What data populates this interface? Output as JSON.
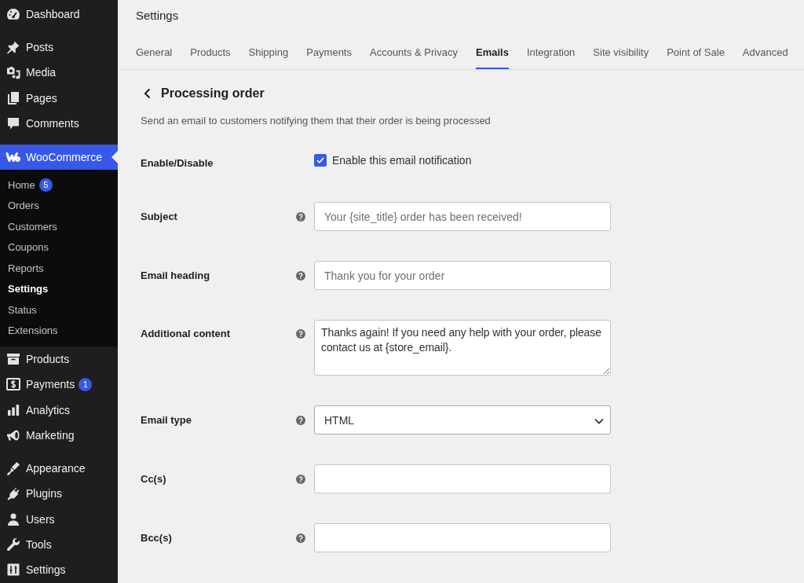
{
  "sidebar": {
    "sections": [
      {
        "items": [
          {
            "label": "Dashboard",
            "selected": false
          }
        ]
      },
      {
        "items": [
          {
            "label": "Posts",
            "selected": false
          },
          {
            "label": "Media",
            "selected": false
          },
          {
            "label": "Pages",
            "selected": false
          },
          {
            "label": "Comments",
            "selected": false
          }
        ]
      },
      {
        "items": [
          {
            "label": "WooCommerce",
            "selected": true,
            "children": [
              {
                "label": "Home",
                "selected": false,
                "badge": "5"
              },
              {
                "label": "Orders",
                "selected": false
              },
              {
                "label": "Customers",
                "selected": false
              },
              {
                "label": "Coupons",
                "selected": false
              },
              {
                "label": "Reports",
                "selected": false
              },
              {
                "label": "Settings",
                "selected": true
              },
              {
                "label": "Status",
                "selected": false
              },
              {
                "label": "Extensions",
                "selected": false
              }
            ]
          },
          {
            "label": "Products",
            "selected": false
          },
          {
            "label": "Payments",
            "selected": false,
            "badge": "1"
          },
          {
            "label": "Analytics",
            "selected": false
          },
          {
            "label": "Marketing",
            "selected": false
          }
        ]
      },
      {
        "items": [
          {
            "label": "Appearance",
            "selected": false
          },
          {
            "label": "Plugins",
            "selected": false
          },
          {
            "label": "Users",
            "selected": false
          },
          {
            "label": "Tools",
            "selected": false
          },
          {
            "label": "Settings",
            "selected": false
          }
        ]
      }
    ]
  },
  "header": {
    "title": "Settings",
    "tabs": [
      {
        "label": "General",
        "selected": false
      },
      {
        "label": "Products",
        "selected": false
      },
      {
        "label": "Shipping",
        "selected": false
      },
      {
        "label": "Payments",
        "selected": false
      },
      {
        "label": "Accounts & Privacy",
        "selected": false
      },
      {
        "label": "Emails",
        "selected": true
      },
      {
        "label": "Integration",
        "selected": false
      },
      {
        "label": "Site visibility",
        "selected": false
      },
      {
        "label": "Point of Sale",
        "selected": false
      },
      {
        "label": "Advanced",
        "selected": false
      }
    ]
  },
  "page": {
    "title": "Processing order",
    "description": "Send an email to customers notifying them that their order is being processed",
    "fields": [
      {
        "kind": "checkbox",
        "label": "Enable/Disable",
        "checked": true,
        "option_label": "Enable this email notification"
      },
      {
        "kind": "text",
        "label": "Subject",
        "placeholder": "Your {site_title} order has been received!"
      },
      {
        "kind": "text",
        "label": "Email heading",
        "placeholder": "Thank you for your order"
      },
      {
        "kind": "textarea",
        "label": "Additional content",
        "value": "Thanks again! If you need any help with your order, please contact us at {store_email}."
      },
      {
        "kind": "select",
        "label": "Email type",
        "value": "HTML"
      },
      {
        "kind": "text",
        "label": "Cc(s)"
      },
      {
        "kind": "text",
        "label": "Bcc(s)"
      }
    ]
  }
}
